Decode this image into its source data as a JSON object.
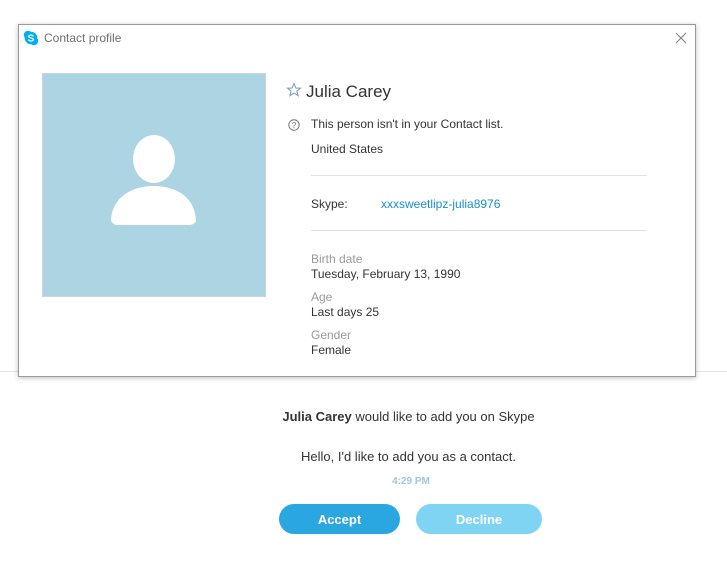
{
  "dialog": {
    "title": "Contact profile",
    "contact_name": "Julia Carey",
    "not_in_list": "This person isn't in your Contact list.",
    "location": "United States",
    "skype_label": "Skype:",
    "skype_id": "xxxsweetlipz-julia8976",
    "birth_label": "Birth date",
    "birth_value": "Tuesday, February 13, 1990",
    "age_label": "Age",
    "age_value": "Last days 25",
    "gender_label": "Gender",
    "gender_value": "Female"
  },
  "request": {
    "name": "Julia Carey",
    "action": " would like to add you on Skype",
    "message": "Hello, I'd like to add you as a contact.",
    "time": "4:29 PM",
    "accept_label": "Accept",
    "decline_label": "Decline"
  },
  "colors": {
    "skype_blue": "#00aff0",
    "accept": "#2aa7e0",
    "decline": "#7fd4f4",
    "avatar_bg": "#acd4e3",
    "link": "#1a8fc9"
  },
  "icons": [
    "skype-logo-icon",
    "close-icon",
    "star-icon",
    "help-icon",
    "person-silhouette-icon"
  ]
}
